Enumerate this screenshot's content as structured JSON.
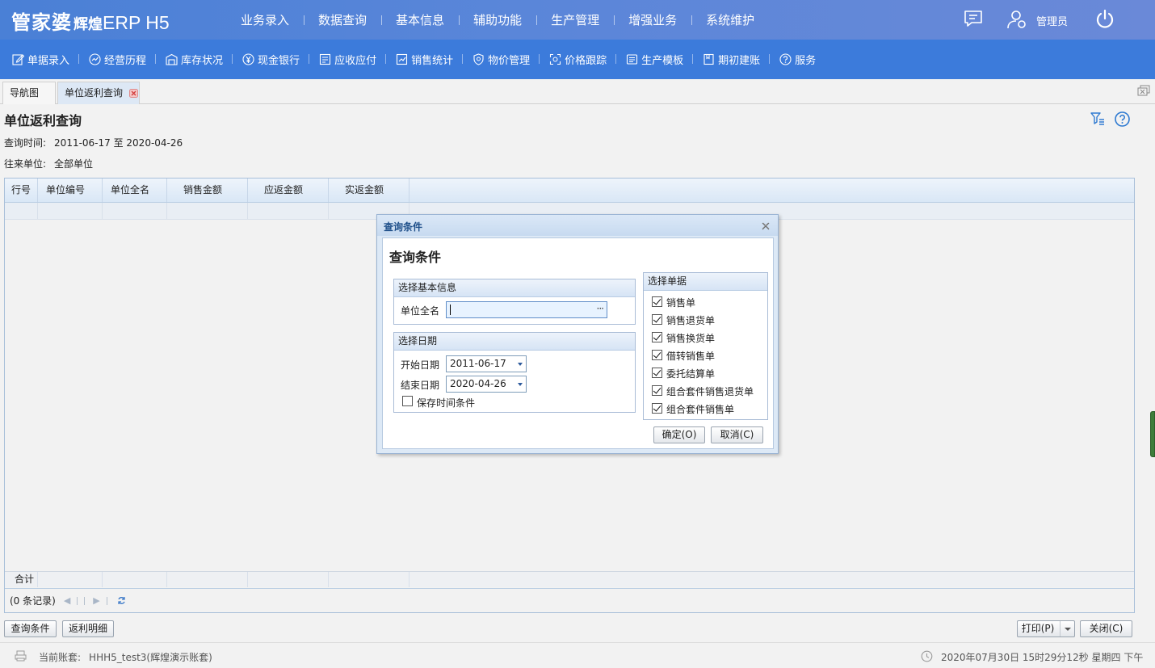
{
  "app": {
    "logo_main": "管家婆",
    "logo_sub": "辉煌",
    "logo_suffix": "ERP H5",
    "user_name": "管理员"
  },
  "main_nav": [
    "业务录入",
    "数据查询",
    "基本信息",
    "辅助功能",
    "生产管理",
    "增强业务",
    "系统维护"
  ],
  "toolbar": [
    {
      "label": "单据录入",
      "icon": "edit-icon"
    },
    {
      "label": "经营历程",
      "icon": "trend-icon"
    },
    {
      "label": "库存状况",
      "icon": "warehouse-icon"
    },
    {
      "label": "现金银行",
      "icon": "yen-icon"
    },
    {
      "label": "应收应付",
      "icon": "ledger-icon"
    },
    {
      "label": "销售统计",
      "icon": "chart-icon"
    },
    {
      "label": "物价管理",
      "icon": "price-shield-icon"
    },
    {
      "label": "价格跟踪",
      "icon": "scan-icon"
    },
    {
      "label": "生产模板",
      "icon": "template-icon"
    },
    {
      "label": "期初建账",
      "icon": "book-icon"
    },
    {
      "label": "服务",
      "icon": "help-icon"
    }
  ],
  "tabs": {
    "nav_tab": "导航图",
    "active_tab": "单位返利查询"
  },
  "page": {
    "title": "单位返利查询",
    "query_time_label": "查询时间:",
    "query_time_value": "2011-06-17 至 2020-04-26",
    "unit_label": "往来单位:",
    "unit_value": "全部单位"
  },
  "grid": {
    "columns": [
      "行号",
      "单位编号",
      "单位全名",
      "销售金额",
      "应返金额",
      "实返金额"
    ],
    "footer_label": "合计",
    "record_count": "(0 条记录)"
  },
  "buttons": {
    "query_conditions": "查询条件",
    "rebate_detail": "返利明细",
    "print": "打印(P)",
    "close": "关闭(C)"
  },
  "status": {
    "account_label": "当前账套:",
    "account_value": "HHH5_test3(辉煌演示账套)",
    "datetime": "2020年07月30日 15时29分12秒 星期四 下午"
  },
  "modal": {
    "header": "查询条件",
    "title": "查询条件",
    "basic_info_section": "选择基本信息",
    "unit_fullname_label": "单位全名",
    "unit_fullname_value": "",
    "ellipsis": "···",
    "date_section": "选择日期",
    "start_date_label": "开始日期",
    "start_date_value": "2011-06-17",
    "end_date_label": "结束日期",
    "end_date_value": "2020-04-26",
    "save_time_label": "保存时间条件",
    "save_time_checked": false,
    "doc_section": "选择单据",
    "doc_types": [
      {
        "label": "销售单",
        "checked": true
      },
      {
        "label": "销售退货单",
        "checked": true
      },
      {
        "label": "销售换货单",
        "checked": true
      },
      {
        "label": "借转销售单",
        "checked": true
      },
      {
        "label": "委托结算单",
        "checked": true
      },
      {
        "label": "组合套件销售退货单",
        "checked": true
      },
      {
        "label": "组合套件销售单",
        "checked": true
      }
    ],
    "ok_button": "确定(O)",
    "cancel_button": "取消(C)"
  }
}
